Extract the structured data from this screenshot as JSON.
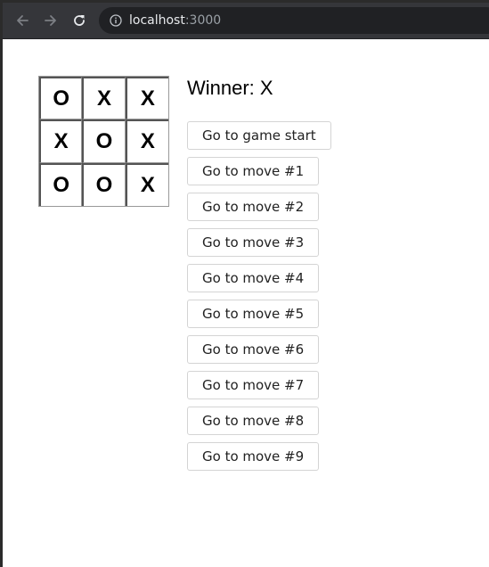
{
  "browser": {
    "url_host": "localhost",
    "url_port": ":3000",
    "icons": {
      "back": "arrow-left-icon",
      "forward": "arrow-right-icon",
      "reload": "reload-icon",
      "info": "info-icon"
    }
  },
  "game": {
    "board": [
      [
        "O",
        "X",
        "X"
      ],
      [
        "X",
        "O",
        "X"
      ],
      [
        "O",
        "O",
        "X"
      ]
    ],
    "status": "Winner: X",
    "moves": [
      "Go to game start",
      "Go to move #1",
      "Go to move #2",
      "Go to move #3",
      "Go to move #4",
      "Go to move #5",
      "Go to move #6",
      "Go to move #7",
      "Go to move #8",
      "Go to move #9"
    ]
  },
  "colors": {
    "toolbar_bg": "#35363a",
    "address_bg": "#202124",
    "board_border": "#999999"
  }
}
